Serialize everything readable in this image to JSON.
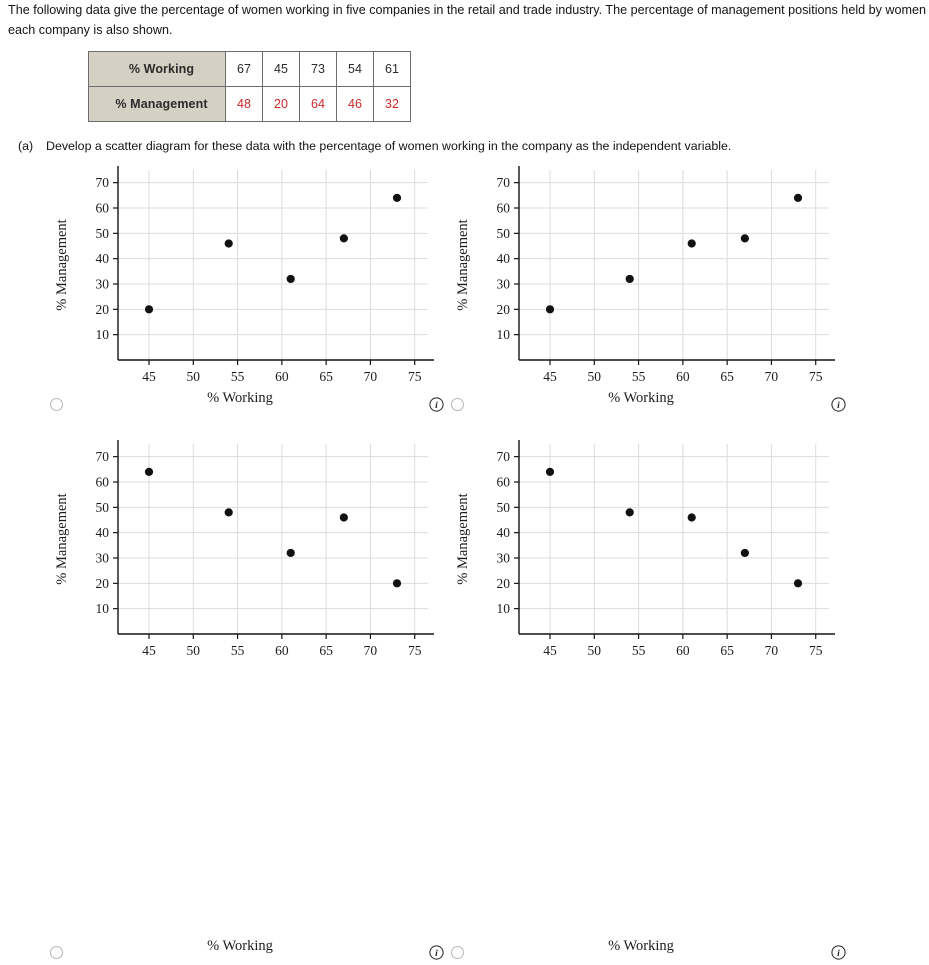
{
  "intro": {
    "paragraph": "The following data give the percentage of women working in five companies in the retail and trade industry. The percentage of management positions held by women in each company is also shown."
  },
  "table": {
    "rows": [
      {
        "header": "% Working",
        "values": [
          "67",
          "45",
          "73",
          "54",
          "61"
        ],
        "value_color": "#2b2b2b"
      },
      {
        "header": "% Management",
        "values": [
          "48",
          "20",
          "64",
          "46",
          "32"
        ],
        "value_color": "#cf2a2a"
      }
    ],
    "header_bg": "#d4d0c4"
  },
  "question": {
    "label": "(a)",
    "text": "Develop a scatter diagram for these data with the percentage of women working in the company as the independent variable."
  },
  "options": [
    {
      "id": "option-a",
      "radio_name": "scatter-option-a-radio",
      "selected": false,
      "info_icon": "info-icon",
      "chart_ref": 0
    },
    {
      "id": "option-b",
      "radio_name": "scatter-option-b-radio",
      "selected": false,
      "info_icon": "info-icon",
      "chart_ref": 1
    },
    {
      "id": "option-c",
      "radio_name": "scatter-option-c-radio",
      "selected": false,
      "info_icon": "info-icon",
      "chart_ref": 2
    },
    {
      "id": "option-d",
      "radio_name": "scatter-option-d-radio",
      "selected": false,
      "info_icon": "info-icon",
      "chart_ref": 3
    }
  ],
  "chart_data": [
    {
      "type": "scatter",
      "title": "",
      "xlabel": "% Working",
      "ylabel": "% Management",
      "xlim": [
        41.5,
        76.5
      ],
      "ylim": [
        0,
        75
      ],
      "xticks": [
        45,
        50,
        55,
        60,
        65,
        70,
        75
      ],
      "yticks": [
        10,
        20,
        30,
        40,
        50,
        60,
        70
      ],
      "grid": true,
      "legend": "none",
      "marker_color": "#111111",
      "x": [
        45,
        54,
        61,
        67,
        73
      ],
      "y": [
        20,
        46,
        32,
        48,
        64
      ]
    },
    {
      "type": "scatter",
      "title": "",
      "xlabel": "% Working",
      "ylabel": "% Management",
      "xlim": [
        41.5,
        76.5
      ],
      "ylim": [
        0,
        75
      ],
      "xticks": [
        45,
        50,
        55,
        60,
        65,
        70,
        75
      ],
      "yticks": [
        10,
        20,
        30,
        40,
        50,
        60,
        70
      ],
      "grid": true,
      "legend": "none",
      "marker_color": "#111111",
      "x": [
        45,
        54,
        61,
        67,
        73
      ],
      "y": [
        20,
        32,
        46,
        48,
        64
      ]
    },
    {
      "type": "scatter",
      "title": "",
      "xlabel": "% Working",
      "ylabel": "% Management",
      "xlim": [
        41.5,
        76.5
      ],
      "ylim": [
        0,
        75
      ],
      "xticks": [
        45,
        50,
        55,
        60,
        65,
        70,
        75
      ],
      "yticks": [
        10,
        20,
        30,
        40,
        50,
        60,
        70
      ],
      "grid": true,
      "legend": "none",
      "marker_color": "#111111",
      "x": [
        45,
        54,
        61,
        67,
        73
      ],
      "y": [
        64,
        48,
        32,
        46,
        20
      ]
    },
    {
      "type": "scatter",
      "title": "",
      "xlabel": "% Working",
      "ylabel": "% Management",
      "xlim": [
        41.5,
        76.5
      ],
      "ylim": [
        0,
        75
      ],
      "xticks": [
        45,
        50,
        55,
        60,
        65,
        70,
        75
      ],
      "yticks": [
        10,
        20,
        30,
        40,
        50,
        60,
        70
      ],
      "grid": true,
      "legend": "none",
      "marker_color": "#111111",
      "x": [
        45,
        54,
        61,
        67,
        73
      ],
      "y": [
        64,
        48,
        46,
        32,
        20
      ]
    }
  ]
}
